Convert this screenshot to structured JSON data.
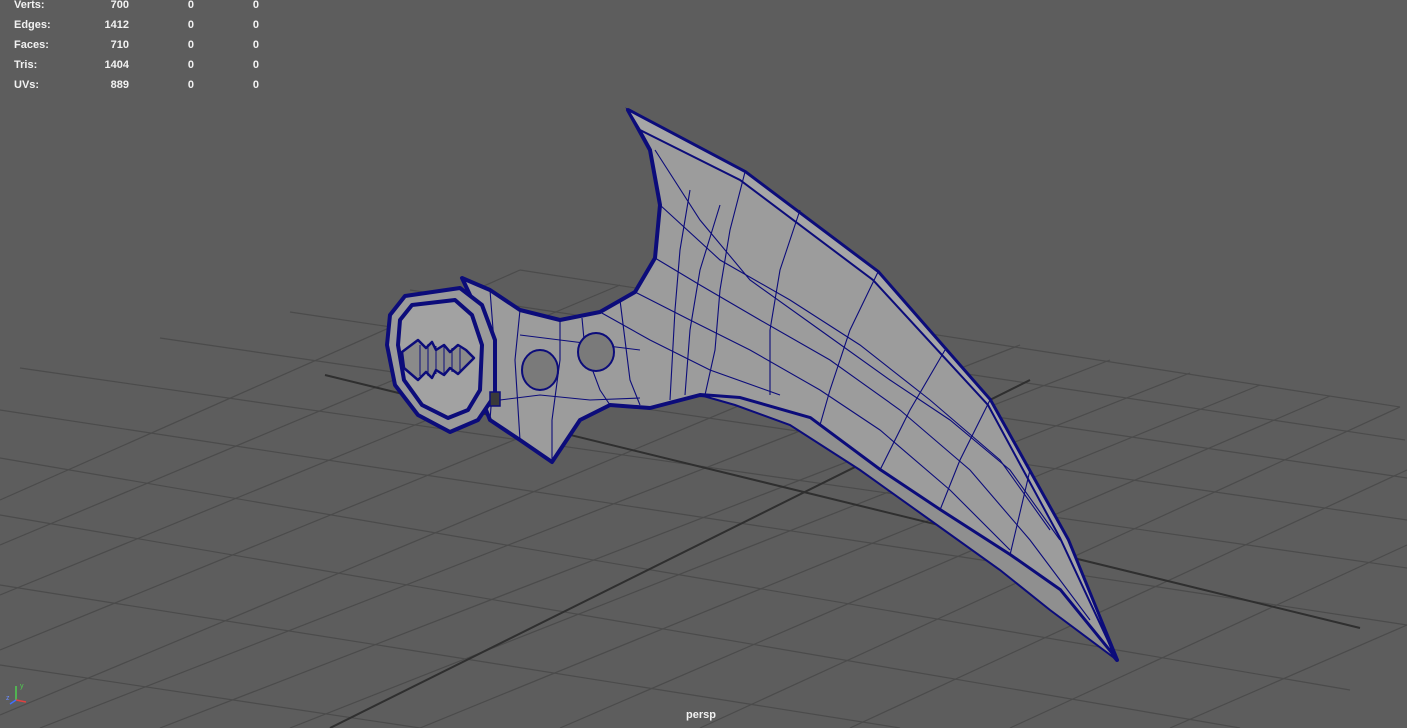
{
  "hud": {
    "rows": [
      {
        "label": "Verts:",
        "v1": "700",
        "v2": "0",
        "v3": "0"
      },
      {
        "label": "Edges:",
        "v1": "1412",
        "v2": "0",
        "v3": "0"
      },
      {
        "label": "Faces:",
        "v1": "710",
        "v2": "0",
        "v3": "0"
      },
      {
        "label": "Tris:",
        "v1": "1404",
        "v2": "0",
        "v3": "0"
      },
      {
        "label": "UVs:",
        "v1": "889",
        "v2": "0",
        "v3": "0"
      }
    ]
  },
  "camera": {
    "name": "persp"
  },
  "gizmo": {
    "y": "y",
    "z": "z"
  },
  "colors": {
    "background": "#5d5d5d",
    "grid": "#4a4a4a",
    "grid_axis": "#2e2e2e",
    "mesh_fill": "#9a9a9a",
    "wire": "#0c0c7a"
  }
}
